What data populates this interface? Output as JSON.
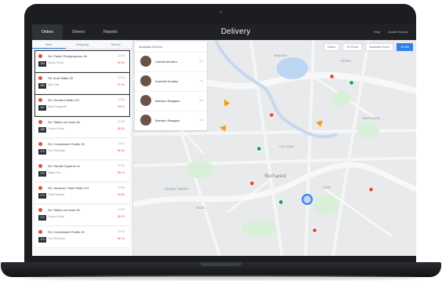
{
  "brand": "Delivery",
  "topnav": [
    "Orders",
    "Drivers",
    "Reports"
  ],
  "top_right": [
    "Help",
    "Austin Hanson"
  ],
  "subtabs": [
    "New",
    "Outgoing",
    "History"
  ],
  "orders": [
    {
      "address": "Str. Pantin Protopopescu 46",
      "name": "Sandy Porter",
      "id": "164",
      "time": "12:30",
      "amount": "$9.50"
    },
    {
      "address": "Str. Arod Watts 39",
      "name": "Sam Rail",
      "id": "169",
      "time": "12:34",
      "amount": "$7.45"
    },
    {
      "address": "Str. Gerhard Walls 121",
      "name": "Sara Fitzgerald",
      "id": "167",
      "time": "12:35",
      "amount": "$12.6"
    },
    {
      "address": "Str. Stefan cel mare 48",
      "name": "Camus Pelee",
      "id": "168",
      "time": "12:38",
      "amount": "$8.30"
    },
    {
      "address": "Str. Crookshank Prairie 29",
      "name": "Tom Robinson",
      "id": "170",
      "time": "12:41",
      "amount": "$6.90"
    },
    {
      "address": "Str. Handle Squares x1",
      "name": "Edgar Fox",
      "id": "170",
      "time": "12:42",
      "amount": "$5.10"
    },
    {
      "address": "Str. Jameson Track Suite 174",
      "name": "Chad Stewart",
      "id": "171",
      "time": "12:46",
      "amount": "$4.80"
    },
    {
      "address": "Str. Stefan cel mare 48",
      "name": "Camus Pelee",
      "id": "172",
      "time": "12:50",
      "amount": "$8.30"
    },
    {
      "address": "Str. Crookshank Prairie 29",
      "name": "Tom Robinson",
      "id": "173",
      "time": "12:52",
      "amount": "$6.10"
    }
  ],
  "map_toolbar": [
    "Orders",
    "On Route",
    "Available Drivers",
    "30 Min"
  ],
  "drivers_title": "Available Drivers",
  "drivers": [
    {
      "name": "Carlota Montero",
      "meta": "1.2"
    },
    {
      "name": "Dominik Doudny",
      "meta": "1.4"
    },
    {
      "name": "Mariano Rasgado",
      "meta": "1.6"
    },
    {
      "name": "Mariano Rasgado",
      "meta": "1.8"
    }
  ],
  "city": "Bucharest",
  "map_labels": [
    "OLD TOWN",
    "PANTELIMON",
    "PIPERA",
    "DRUMUL TABEREI",
    "TITAN",
    "BANEASA",
    "PACEA"
  ]
}
